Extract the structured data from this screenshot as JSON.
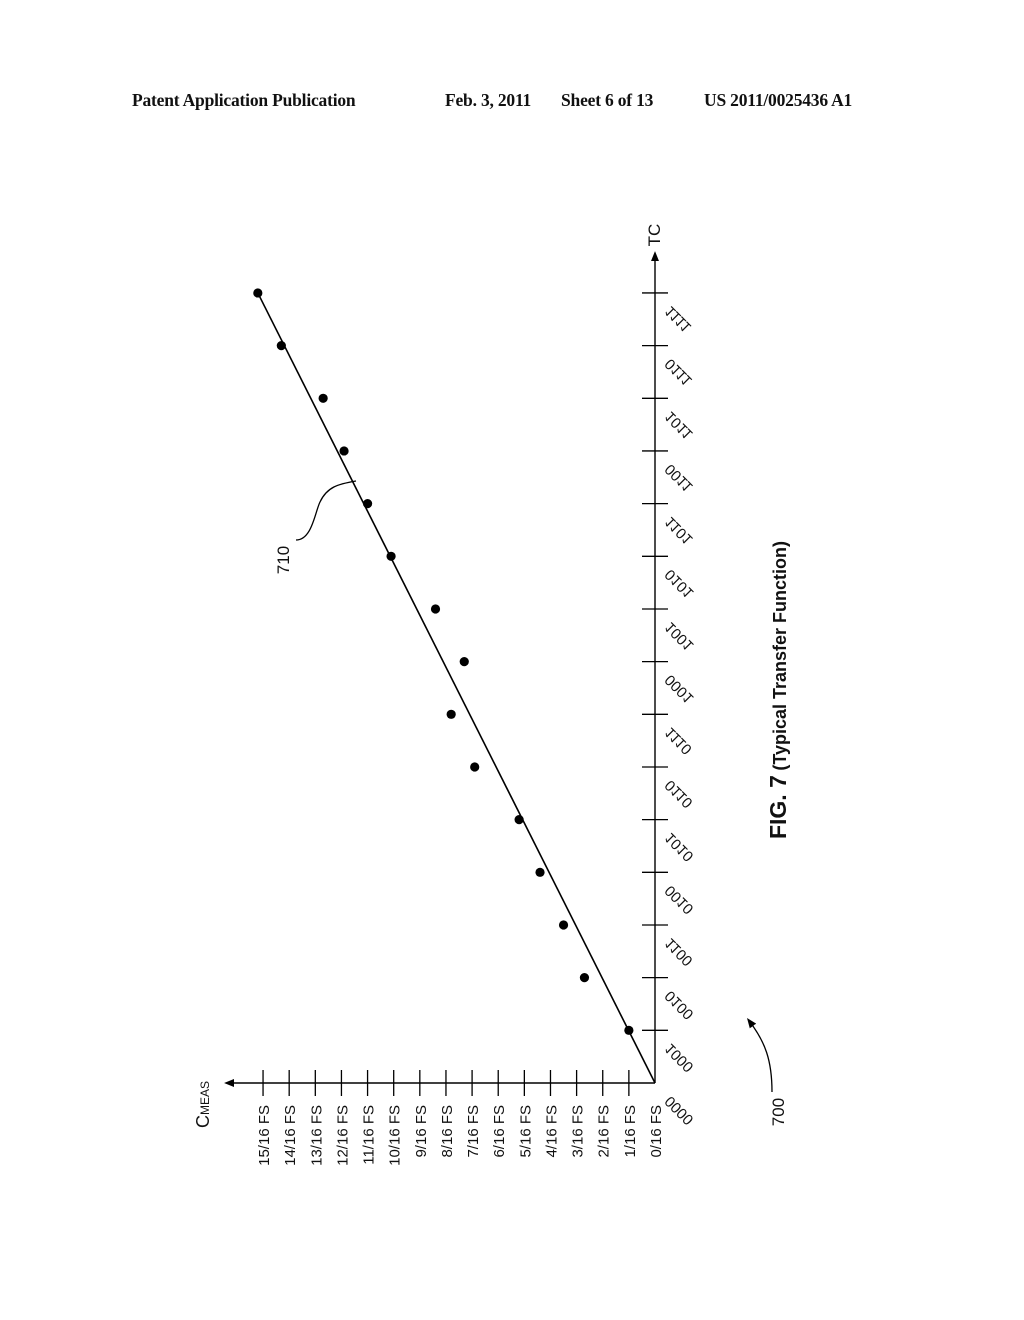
{
  "header": {
    "publication": "Patent Application Publication",
    "date": "Feb. 3, 2011",
    "sheet": "Sheet 6 of 13",
    "number": "US 2011/0025436 A1"
  },
  "figure": {
    "caption_fig": "FIG. 7",
    "caption_text": "(Typical Transfer Function)",
    "ref_figure": "700",
    "ref_line": "710"
  },
  "chart_data": {
    "type": "scatter",
    "title": "FIG. 7 (Typical Transfer Function)",
    "orientation": "rotated 90° counter-clockwise on page",
    "xlabel": "TC",
    "ylabel": "C_MEAS",
    "ylabel_main": "C",
    "ylabel_sub": "MEAS",
    "x_ticks": [
      "0000",
      "0001",
      "0010",
      "0011",
      "0100",
      "0101",
      "0110",
      "0111",
      "1000",
      "1001",
      "1010",
      "1011",
      "1100",
      "1101",
      "1110",
      "1111"
    ],
    "y_ticks": [
      "0/16 FS",
      "1/16 FS",
      "2/16 FS",
      "3/16 FS",
      "4/16 FS",
      "5/16 FS",
      "6/16 FS",
      "7/16 FS",
      "8/16 FS",
      "9/16 FS",
      "10/16 FS",
      "11/16 FS",
      "12/16 FS",
      "13/16 FS",
      "14/16 FS",
      "15/16 FS"
    ],
    "x_range": [
      0,
      15.7
    ],
    "y_range_sixteenths_FS": [
      0,
      16.3
    ],
    "series": [
      {
        "name": "measured points",
        "x": [
          "0001",
          "0010",
          "0011",
          "0100",
          "0101",
          "0110",
          "0111",
          "1000",
          "1001",
          "1010",
          "1011",
          "1100",
          "1101",
          "1110",
          "1111"
        ],
        "y_sixteenths_FS": [
          1.0,
          2.7,
          3.5,
          4.4,
          5.2,
          6.9,
          7.8,
          7.3,
          8.4,
          10.1,
          11.0,
          11.9,
          12.7,
          14.3,
          15.2
        ]
      },
      {
        "name": "typical transfer function (710)",
        "type": "line",
        "x_index": [
          0,
          15
        ],
        "y_sixteenths_FS": [
          0,
          15.2
        ]
      }
    ],
    "grid": false,
    "legend": "none"
  }
}
